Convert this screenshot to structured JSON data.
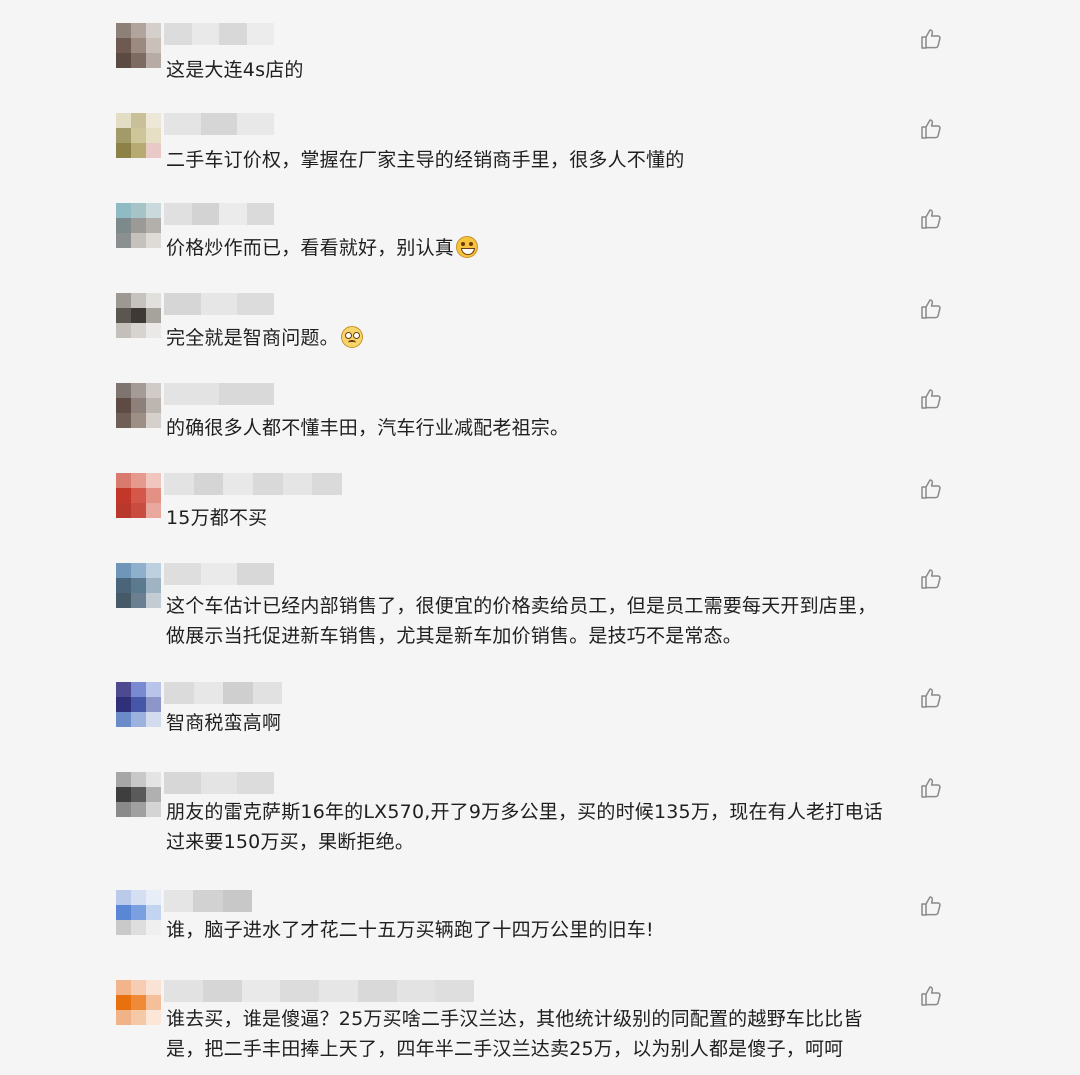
{
  "comments": [
    {
      "text": "这是大连4s店的",
      "emoji": ""
    },
    {
      "text": "二手车订价权，掌握在厂家主导的经销商手里，很多人不懂的",
      "emoji": ""
    },
    {
      "text": "价格炒作而已，看看就好，别认真",
      "emoji": "grinning-face-emoji"
    },
    {
      "text": "完全就是智商问题。",
      "emoji": "worried-face-emoji"
    },
    {
      "text": "的确很多人都不懂丰田，汽车行业减配老祖宗。",
      "emoji": ""
    },
    {
      "text": "15万都不买",
      "emoji": ""
    },
    {
      "text": "这个车估计已经内部销售了，很便宜的价格卖给员工，但是员工需要每天开到店里，\n做展示当托促进新车销售，尤其是新车加价销售。是技巧不是常态。",
      "emoji": ""
    },
    {
      "text": "智商税蛮高啊",
      "emoji": ""
    },
    {
      "text": "朋友的雷克萨斯16年的LX570,开了9万多公里，买的时候135万，现在有人老打电话\n过来要150万买，果断拒绝。",
      "emoji": ""
    },
    {
      "text": "谁，脑子进水了才花二十五万买辆跑了十四万公里的旧车!",
      "emoji": ""
    },
    {
      "text": "谁去买，谁是傻逼？25万买啥二手汉兰达，其他统计级别的同配置的越野车比比皆\n是，把二手丰田捧上天了，四年半二手汉兰达卖25万，以为别人都是傻子，呵呵",
      "emoji": ""
    }
  ],
  "icons": {
    "like": "thumbs-up-icon"
  },
  "colors": {
    "background": "#f5f5f5",
    "text": "#1f1f1f",
    "icon": "#8a8a8a"
  }
}
